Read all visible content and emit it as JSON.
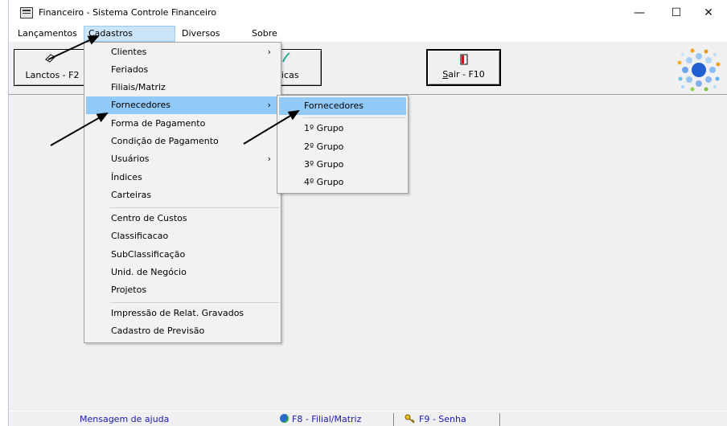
{
  "window": {
    "title": "Financeiro - Sistema Controle Financeiro",
    "minimize_glyph": "—",
    "maximize_glyph": "☐",
    "close_glyph": "✕"
  },
  "menubar": {
    "items": [
      {
        "label": "Lançamentos"
      },
      {
        "label": "Cadastros"
      },
      {
        "label": "Diversos"
      },
      {
        "label": "Sobre"
      }
    ]
  },
  "toolbar": {
    "lanctos_label": "Lanctos - F2",
    "graficas_label": "icas",
    "sair_label": "Sair - F10",
    "sair_accel": "S",
    "sair_rest": "air - F10"
  },
  "cadastros_menu": {
    "items": [
      {
        "label": "Clientes",
        "submenu": true
      },
      {
        "label": "Feriados"
      },
      {
        "label": "Filiais/Matriz"
      },
      {
        "label": "Fornecedores",
        "submenu": true,
        "highlighted": true
      },
      {
        "label": "Forma de Pagamento"
      },
      {
        "label": "Condição de Pagamento"
      },
      {
        "label": "Usuários",
        "submenu": true
      },
      {
        "label": "Índices"
      },
      {
        "label": "Carteiras"
      },
      {
        "label": "Centro de Custos"
      },
      {
        "label": "Classificacao"
      },
      {
        "label": "SubClassificação"
      },
      {
        "label": "Unid. de Negócio"
      },
      {
        "label": "Projetos"
      },
      {
        "label": "Impressão de Relat. Gravados"
      },
      {
        "label": "Cadastro de Previsão"
      }
    ],
    "submenu_arrow": "›"
  },
  "fornecedores_submenu": {
    "items": [
      {
        "label": "Fornecedores",
        "highlighted": true
      },
      {
        "label": "1º Grupo"
      },
      {
        "label": "2º Grupo"
      },
      {
        "label": "3º Grupo"
      },
      {
        "label": "4º Grupo"
      }
    ]
  },
  "statusbar": {
    "help_text": "Mensagem de ajuda",
    "filial_text": "F8 - Filial/Matriz",
    "senha_text": "F9 - Senha"
  },
  "colors": {
    "menu_highlight": "#91c9f7",
    "menubar_active": "#cce4f7",
    "status_text": "#1a1ab0",
    "window_bg": "#f0f0f0"
  }
}
